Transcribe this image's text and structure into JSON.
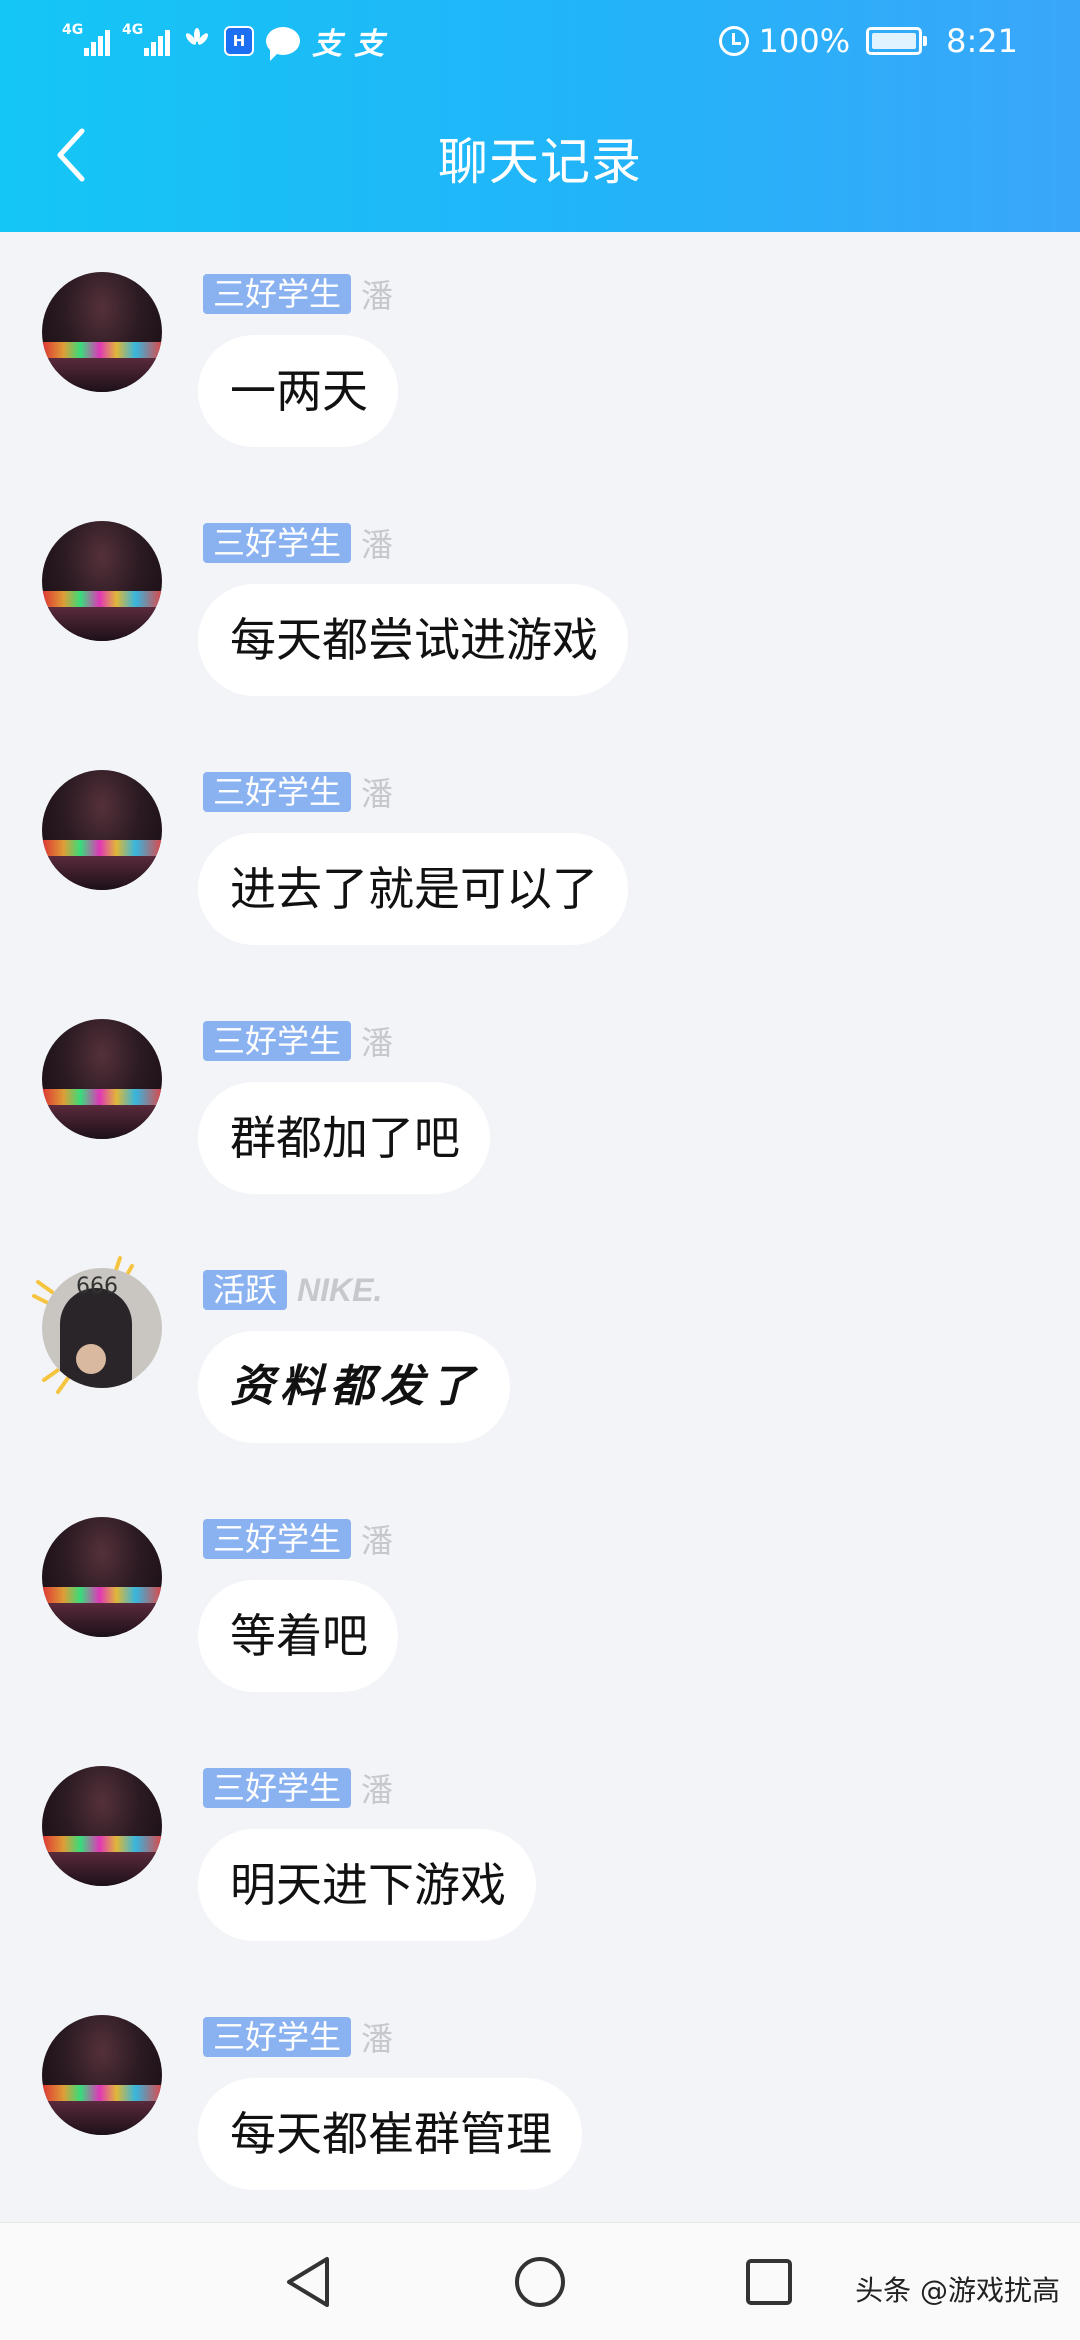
{
  "status_bar": {
    "network_1": "4G",
    "network_2": "4G",
    "app_icon_text": "支",
    "battery": "100%",
    "time": "8:21"
  },
  "header": {
    "title": "聊天记录"
  },
  "messages": [
    {
      "badge": "三好学生",
      "name": "潘",
      "text": "一两天",
      "avatar": "night-city"
    },
    {
      "badge": "三好学生",
      "name": "潘",
      "text": "每天都尝试进游戏",
      "avatar": "night-city"
    },
    {
      "badge": "三好学生",
      "name": "潘",
      "text": "进去了就是可以了",
      "avatar": "night-city"
    },
    {
      "badge": "三好学生",
      "name": "潘",
      "text": "群都加了吧",
      "avatar": "night-city"
    },
    {
      "badge": "活跃",
      "name": "NIKE.",
      "text": "资料都发了",
      "avatar": "person-photo"
    },
    {
      "badge": "三好学生",
      "name": "潘",
      "text": "等着吧",
      "avatar": "night-city"
    },
    {
      "badge": "三好学生",
      "name": "潘",
      "text": "明天进下游戏",
      "avatar": "night-city"
    },
    {
      "badge": "三好学生",
      "name": "潘",
      "text": "每天都崔群管理",
      "avatar": "night-city"
    }
  ],
  "nav_bar": {
    "watermark": "头条 @游戏扰高"
  },
  "colors": {
    "header_gradient_start": "#14c6f6",
    "header_gradient_end": "#3aa6fa",
    "badge_bg": "#8bb2f0",
    "chat_bg": "#f3f4f8",
    "bubble_bg": "#ffffff"
  }
}
